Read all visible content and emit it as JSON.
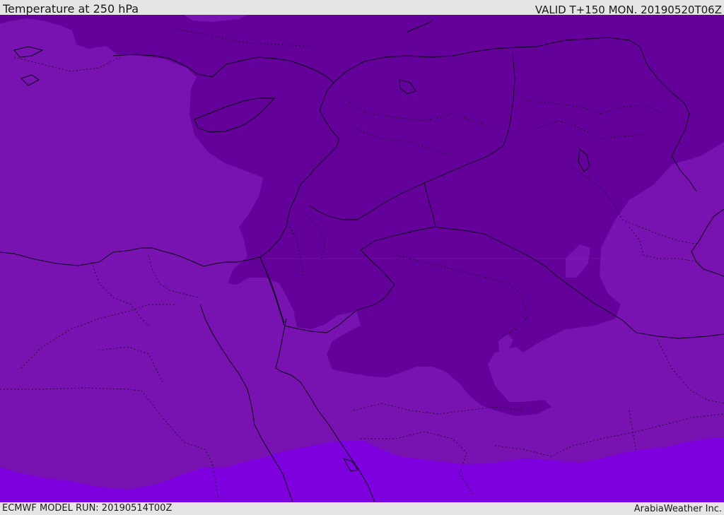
{
  "header": {
    "title": "Temperature at 250 hPa",
    "valid_time": "VALID T+150 MON. 20190520T06Z"
  },
  "footer": {
    "model_run": "ECMWF MODEL RUN: 20190514T00Z",
    "credit": "ArabiaWeather Inc."
  },
  "map": {
    "colors": {
      "band_mid": "#7812b0",
      "band_cold": "#64019a",
      "band_warm": "#7f00de",
      "coastline": "#0a0014",
      "border": "#0a0014"
    }
  }
}
